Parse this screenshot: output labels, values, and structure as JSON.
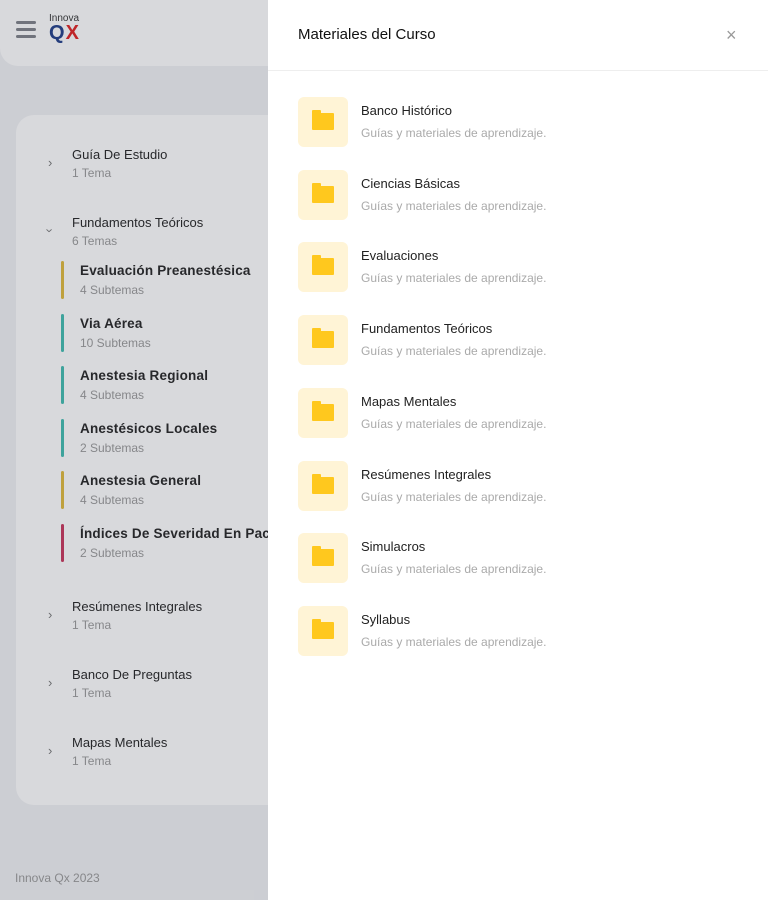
{
  "header": {
    "logo_small": "Innova",
    "logo_q": "Q",
    "logo_x": "X"
  },
  "sidebar": {
    "groups": [
      {
        "title": "Guía De Estudio",
        "count": "1 Tema",
        "expanded": false
      },
      {
        "title": "Fundamentos Teóricos",
        "count": "6 Temas",
        "expanded": true,
        "subs": [
          {
            "title": "Evaluación Preanestésica",
            "count": "4 Subtemas",
            "color": "#e0b93a"
          },
          {
            "title": "Via Aérea",
            "count": "10 Subtemas",
            "color": "#3fbcb0"
          },
          {
            "title": "Anestesia Regional",
            "count": "4 Subtemas",
            "color": "#3fbcb0"
          },
          {
            "title": "Anestésicos Locales",
            "count": "2 Subtemas",
            "color": "#3fbcb0"
          },
          {
            "title": "Anestesia General",
            "count": "4 Subtemas",
            "color": "#e0b93a"
          },
          {
            "title": "Índices De Severidad En Pacientes",
            "count": "2 Subtemas",
            "color": "#c8345a"
          }
        ]
      },
      {
        "title": "Resúmenes Integrales",
        "count": "1 Tema",
        "expanded": false
      },
      {
        "title": "Banco De Preguntas",
        "count": "1 Tema",
        "expanded": false
      },
      {
        "title": "Mapas Mentales",
        "count": "1 Tema",
        "expanded": false
      }
    ]
  },
  "footer": "Innova Qx 2023",
  "drawer": {
    "title": "Materiales del Curso",
    "close_icon": "×",
    "items": [
      {
        "title": "Banco Histórico",
        "subtitle": "Guías y materiales de aprendizaje."
      },
      {
        "title": "Ciencias Básicas",
        "subtitle": "Guías y materiales de aprendizaje."
      },
      {
        "title": "Evaluaciones",
        "subtitle": "Guías y materiales de aprendizaje."
      },
      {
        "title": "Fundamentos Teóricos",
        "subtitle": "Guías y materiales de aprendizaje."
      },
      {
        "title": "Mapas Mentales",
        "subtitle": "Guías y materiales de aprendizaje."
      },
      {
        "title": "Resúmenes Integrales",
        "subtitle": "Guías y materiales de aprendizaje."
      },
      {
        "title": "Simulacros",
        "subtitle": "Guías y materiales de aprendizaje."
      },
      {
        "title": "Syllabus",
        "subtitle": "Guías y materiales de aprendizaje."
      }
    ]
  },
  "colors": {
    "folder": "#ffc81e",
    "folder_bg": "#fff4d6"
  }
}
